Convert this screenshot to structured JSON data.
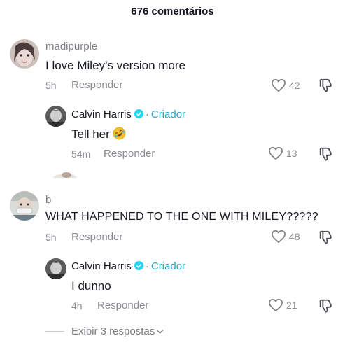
{
  "header": {
    "comment_count": "676 comentários"
  },
  "comments": [
    {
      "username": "madipurple",
      "text": "I love Miley’s version more",
      "time": "5h",
      "reply_label": "Responder",
      "likes": "42"
    },
    {
      "username": "Calvin Harris",
      "separator": "·",
      "creator_label": "Criador",
      "text": "Tell her",
      "emoji": "rolling-on-floor-laughing",
      "time": "54m",
      "reply_label": "Responder",
      "likes": "13"
    },
    {
      "username": "b",
      "text": "WHAT HAPPENED TO THE ONE WITH MILEY?????",
      "time": "5h",
      "reply_label": "Responder",
      "likes": "48"
    },
    {
      "username": "Calvin Harris",
      "separator": "·",
      "creator_label": "Criador",
      "text": "I dunno",
      "time": "4h",
      "reply_label": "Responder",
      "likes": "21"
    }
  ],
  "view_replies": {
    "label": "Exibir 3 respostas"
  },
  "colors": {
    "creator": "#20a8c8",
    "verified": "#20d5ec",
    "meta": "#8a8b91",
    "text": "#161823"
  }
}
